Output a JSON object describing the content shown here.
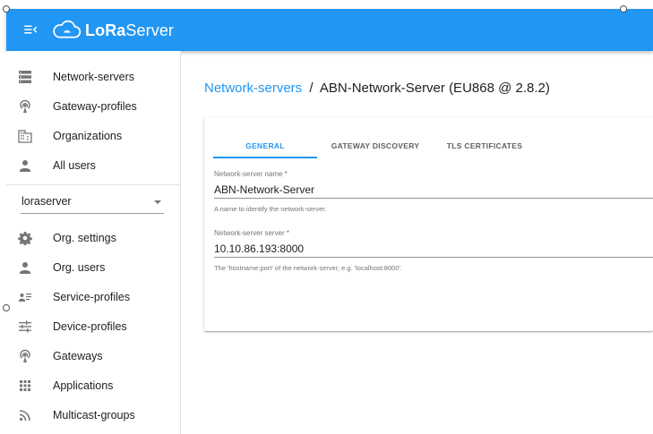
{
  "app": {
    "brand_prefix": "LoRa",
    "brand_suffix": "Server",
    "accent_color": "#2196f3"
  },
  "sidebar": {
    "admin_items": [
      {
        "label": "Network-servers",
        "icon": "server-icon"
      },
      {
        "label": "Gateway-profiles",
        "icon": "radio-tower-icon"
      },
      {
        "label": "Organizations",
        "icon": "domain-icon"
      },
      {
        "label": "All users",
        "icon": "user-icon"
      }
    ],
    "org_selector": {
      "value": "loraserver"
    },
    "org_items": [
      {
        "label": "Org. settings",
        "icon": "gear-icon"
      },
      {
        "label": "Org. users",
        "icon": "user-icon"
      },
      {
        "label": "Service-profiles",
        "icon": "account-details-icon"
      },
      {
        "label": "Device-profiles",
        "icon": "tune-icon"
      },
      {
        "label": "Gateways",
        "icon": "radio-tower-icon"
      },
      {
        "label": "Applications",
        "icon": "apps-grid-icon"
      },
      {
        "label": "Multicast-groups",
        "icon": "rss-icon"
      }
    ]
  },
  "breadcrumb": {
    "parent": "Network-servers",
    "separator": "/",
    "current": "ABN-Network-Server (EU868 @ 2.8.2)"
  },
  "tabs": [
    {
      "label": "General",
      "active": true
    },
    {
      "label": "Gateway discovery",
      "active": false
    },
    {
      "label": "TLS certificates",
      "active": false
    }
  ],
  "form": {
    "name": {
      "label": "Network-server name *",
      "value": "ABN-Network-Server",
      "helper": "A name to identify the network-server."
    },
    "server": {
      "label": "Network-server server *",
      "value": "10.10.86.193:8000",
      "helper": "The 'hostname:port' of the network-server, e.g. 'localhost:8000'."
    }
  }
}
